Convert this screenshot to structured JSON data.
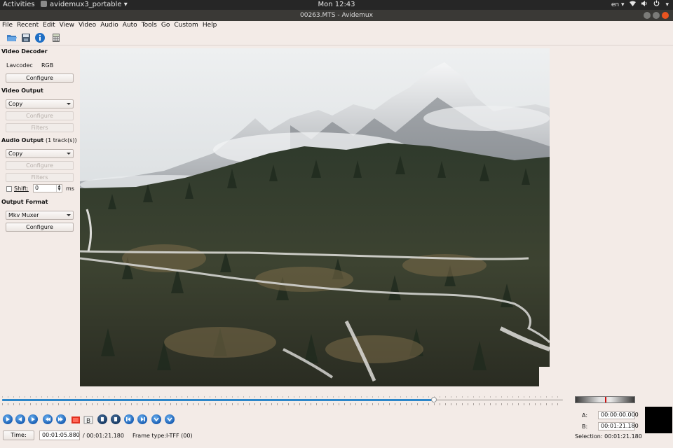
{
  "topbar": {
    "activities": "Activities",
    "app_name": "avidemux3_portable",
    "clock": "Mon 12:43",
    "keyboard": "en"
  },
  "window": {
    "title": "00263.MTS - Avidemux"
  },
  "menu": [
    "File",
    "Recent",
    "Edit",
    "View",
    "Video",
    "Audio",
    "Auto",
    "Tools",
    "Go",
    "Custom",
    "Help"
  ],
  "toolbar": {
    "icons": [
      "open-folder-icon",
      "save-icon",
      "info-icon",
      "calculator-icon"
    ]
  },
  "video_decoder": {
    "title": "Video Decoder",
    "codec": "Lavcodec",
    "colorspace": "RGB",
    "configure": "Configure"
  },
  "video_output": {
    "title": "Video Output",
    "selected": "Copy",
    "configure": "Configure",
    "filters": "Filters"
  },
  "audio_output": {
    "title": "Audio Output",
    "tracks": "(1 track(s))",
    "selected": "Copy",
    "configure": "Configure",
    "filters": "Filters",
    "shift_label": "Shift:",
    "shift_value": "0",
    "shift_unit": "ms"
  },
  "output_format": {
    "title": "Output Format",
    "selected": "Mkv Muxer",
    "configure": "Configure"
  },
  "timeline": {
    "position_fraction": 0.77
  },
  "markers": {
    "a_label": "A:",
    "a_value": "00:00:00.000",
    "b_label": "B:",
    "b_value": "00:01:21.180",
    "selection_label": "Selection:",
    "selection_value": "00:01:21.180"
  },
  "status": {
    "time_button": "Time:",
    "current_time": "00:01:05.880",
    "total_time": "/ 00:01:21.180",
    "frame_type_label": "Frame type:",
    "frame_type_value": "I-TFF (00)"
  },
  "colors": {
    "accent": "#2d86c8",
    "window_bg": "#f3ebe7",
    "close_button": "#e95420"
  }
}
